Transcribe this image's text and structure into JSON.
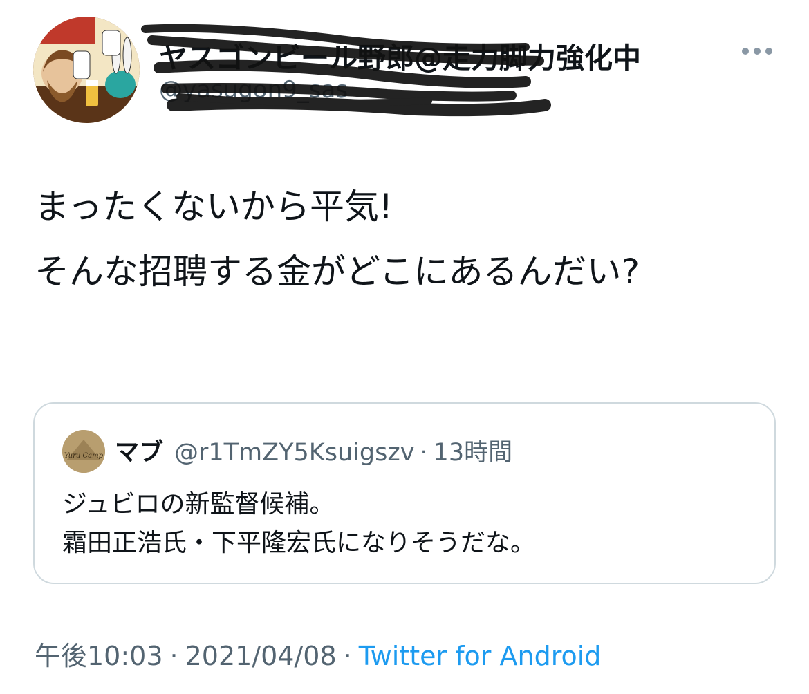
{
  "author": {
    "display_name": "ヤスゴンビール野郎@走力脚力強化中",
    "handle": "@yasugon9_sas",
    "avatar_icon": "illustrated-avatar"
  },
  "more_icon": "more-dots-icon",
  "tweet": {
    "text": "まったくないから平気!\nそんな招聘する金がどこにあるんだい?"
  },
  "quote": {
    "display_name": "マブ",
    "handle": "@r1TmZY5Ksuigszv",
    "dot": "·",
    "time": "13時間",
    "avatar_text": "Yuru Camp",
    "text": "ジュビロの新監督候補。\n霜田正浩氏・下平隆宏氏になりそうだな。"
  },
  "meta": {
    "time": "午後10:03",
    "sep1": "·",
    "date": "2021/04/08",
    "sep2": "·",
    "source": "Twitter for Android"
  },
  "colors": {
    "text_primary": "#0f1419",
    "text_secondary": "#536471",
    "link": "#1d9bf0",
    "border": "#cfd9de"
  }
}
